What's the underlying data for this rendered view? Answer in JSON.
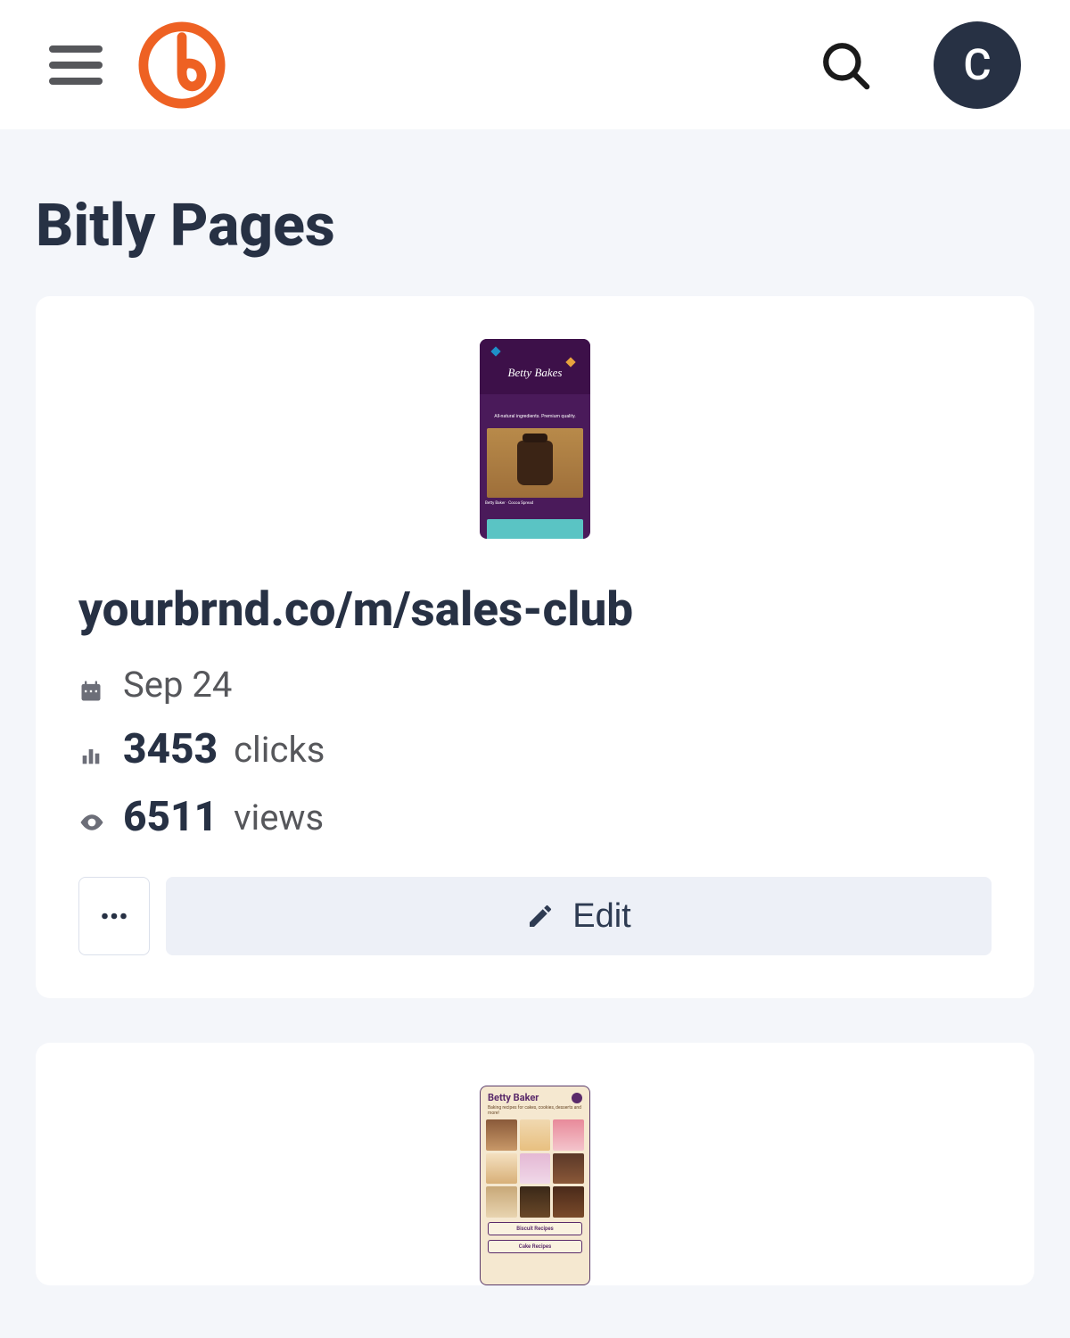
{
  "header": {
    "avatar_initial": "C"
  },
  "page": {
    "title": "Bitly Pages"
  },
  "cards": [
    {
      "url": "yourbrnd.co/m/sales-club",
      "date": "Sep 24",
      "clicks": "3453",
      "clicks_label": "clicks",
      "views": "6511",
      "views_label": "views",
      "edit_label": "Edit",
      "preview": {
        "brand": "Betty Bakes",
        "tagline": "All-natural ingredients. Premium quality.",
        "caption": "Betty Baker · Cocoa Spread"
      }
    },
    {
      "preview": {
        "title": "Betty Baker",
        "subtitle": "Baking recipes for cakes, cookies, desserts and more!",
        "btn1": "Biscuit Recipes",
        "btn2": "Cake Recipes"
      }
    }
  ]
}
